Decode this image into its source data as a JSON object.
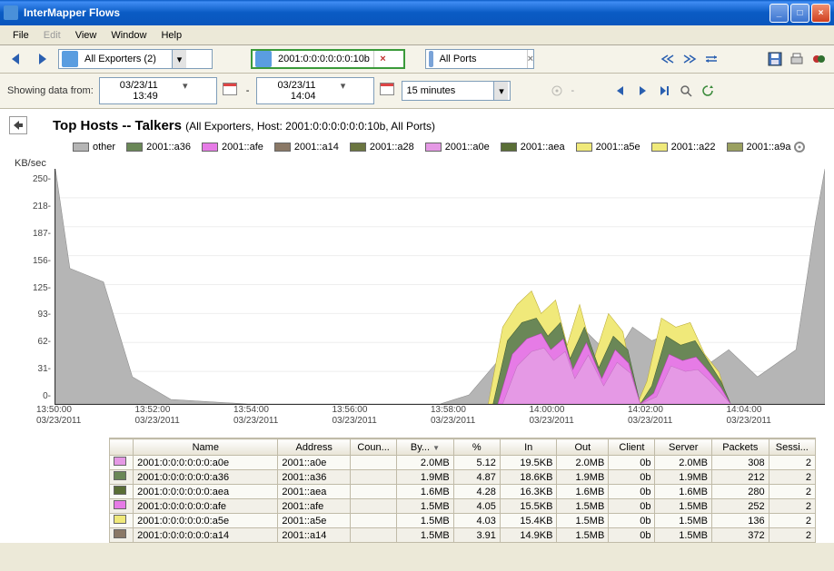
{
  "window": {
    "title": "InterMapper Flows"
  },
  "menu": {
    "file": "File",
    "edit": "Edit",
    "view": "View",
    "window": "Window",
    "help": "Help"
  },
  "toolbar": {
    "exporters_label": "All Exporters (2)",
    "host_filter": "2001:0:0:0:0:0:0:10b",
    "ports_label": "All Ports"
  },
  "timebar": {
    "label": "Showing data from:",
    "start": "03/23/11 13:49",
    "end": "03/23/11 14:04",
    "range": "15 minutes"
  },
  "chart": {
    "title": "Top Hosts -- Talkers",
    "subtitle": "(All Exporters, Host: 2001:0:0:0:0:0:0:10b, All Ports)",
    "ylabel": "KB/sec"
  },
  "legend": [
    {
      "label": "other",
      "cls": "c-other"
    },
    {
      "label": "2001::a36",
      "cls": "c-a36"
    },
    {
      "label": "2001::afe",
      "cls": "c-afe"
    },
    {
      "label": "2001::a14",
      "cls": "c-a14"
    },
    {
      "label": "2001::a28",
      "cls": "c-a28"
    },
    {
      "label": "2001::a0e",
      "cls": "c-a0e"
    },
    {
      "label": "2001::aea",
      "cls": "c-aea"
    },
    {
      "label": "2001::a5e",
      "cls": "c-a5e"
    },
    {
      "label": "2001::a22",
      "cls": "c-a22"
    },
    {
      "label": "2001::a9a",
      "cls": "c-a9a"
    }
  ],
  "chart_data": {
    "type": "area",
    "title": "Top Hosts -- Talkers",
    "ylabel": "KB/sec",
    "ylim": [
      0,
      250
    ],
    "yticks": [
      0,
      31,
      62,
      93,
      125,
      156,
      187,
      218,
      250
    ],
    "xticks": [
      {
        "t": "13:50:00",
        "d": "03/23/2011"
      },
      {
        "t": "13:52:00",
        "d": "03/23/2011"
      },
      {
        "t": "13:54:00",
        "d": "03/23/2011"
      },
      {
        "t": "13:56:00",
        "d": "03/23/2011"
      },
      {
        "t": "13:58:00",
        "d": "03/23/2011"
      },
      {
        "t": "14:00:00",
        "d": "03/23/2011"
      },
      {
        "t": "14:02:00",
        "d": "03/23/2011"
      },
      {
        "t": "14:04:00",
        "d": "03/23/2011"
      }
    ],
    "series_note": "approximate stacked totals read from chart",
    "series": [
      {
        "name": "other",
        "color": "#b5b5b5"
      },
      {
        "name": "2001::a36",
        "color": "#6a8757"
      },
      {
        "name": "2001::afe",
        "color": "#e67be6"
      },
      {
        "name": "2001::a5e",
        "color": "#f0e97a"
      },
      {
        "name": "2001::a0e",
        "color": "#e599e5"
      }
    ],
    "x_samples": [
      "13:49",
      "13:50",
      "13:51",
      "13:52",
      "13:53",
      "13:54",
      "13:55",
      "13:56",
      "13:57",
      "13:58",
      "13:59",
      "14:00",
      "14:01",
      "14:02",
      "14:03",
      "14:04",
      "14:05"
    ],
    "stacked_top_approx": {
      "other": [
        250,
        130,
        30,
        5,
        0,
        0,
        0,
        0,
        10,
        60,
        90,
        50,
        80,
        70,
        40,
        60,
        260
      ],
      "a36": [
        0,
        0,
        0,
        0,
        0,
        0,
        0,
        0,
        0,
        80,
        95,
        60,
        85,
        80,
        70,
        50,
        0
      ],
      "afe": [
        0,
        0,
        0,
        0,
        0,
        0,
        0,
        0,
        0,
        85,
        100,
        40,
        90,
        85,
        55,
        20,
        0
      ],
      "a5e": [
        0,
        0,
        0,
        0,
        0,
        0,
        0,
        0,
        0,
        110,
        120,
        55,
        100,
        95,
        85,
        30,
        0
      ],
      "a0e": [
        0,
        0,
        0,
        0,
        0,
        0,
        0,
        0,
        0,
        70,
        85,
        30,
        75,
        70,
        50,
        15,
        0
      ]
    }
  },
  "table": {
    "headers": [
      "",
      "Name",
      "Address",
      "Coun...",
      "By...",
      "%",
      "In",
      "Out",
      "Client",
      "Server",
      "Packets",
      "Sessi..."
    ],
    "sort_col": "By...",
    "rows": [
      {
        "sw": "c-a0e",
        "name": "2001:0:0:0:0:0:0:a0e",
        "addr": "2001::a0e",
        "coun": "",
        "by": "2.0MB",
        "pct": "5.12",
        "in": "19.5KB",
        "out": "2.0MB",
        "client": "0b",
        "server": "2.0MB",
        "packets": "308",
        "sess": "2"
      },
      {
        "sw": "c-a36",
        "name": "2001:0:0:0:0:0:0:a36",
        "addr": "2001::a36",
        "coun": "",
        "by": "1.9MB",
        "pct": "4.87",
        "in": "18.6KB",
        "out": "1.9MB",
        "client": "0b",
        "server": "1.9MB",
        "packets": "212",
        "sess": "2"
      },
      {
        "sw": "c-aea",
        "name": "2001:0:0:0:0:0:0:aea",
        "addr": "2001::aea",
        "coun": "",
        "by": "1.6MB",
        "pct": "4.28",
        "in": "16.3KB",
        "out": "1.6MB",
        "client": "0b",
        "server": "1.6MB",
        "packets": "280",
        "sess": "2"
      },
      {
        "sw": "c-afe",
        "name": "2001:0:0:0:0:0:0:afe",
        "addr": "2001::afe",
        "coun": "",
        "by": "1.5MB",
        "pct": "4.05",
        "in": "15.5KB",
        "out": "1.5MB",
        "client": "0b",
        "server": "1.5MB",
        "packets": "252",
        "sess": "2"
      },
      {
        "sw": "c-a5e",
        "name": "2001:0:0:0:0:0:0:a5e",
        "addr": "2001::a5e",
        "coun": "",
        "by": "1.5MB",
        "pct": "4.03",
        "in": "15.4KB",
        "out": "1.5MB",
        "client": "0b",
        "server": "1.5MB",
        "packets": "136",
        "sess": "2"
      },
      {
        "sw": "c-a14",
        "name": "2001:0:0:0:0:0:0:a14",
        "addr": "2001::a14",
        "coun": "",
        "by": "1.5MB",
        "pct": "3.91",
        "in": "14.9KB",
        "out": "1.5MB",
        "client": "0b",
        "server": "1.5MB",
        "packets": "372",
        "sess": "2"
      }
    ]
  }
}
